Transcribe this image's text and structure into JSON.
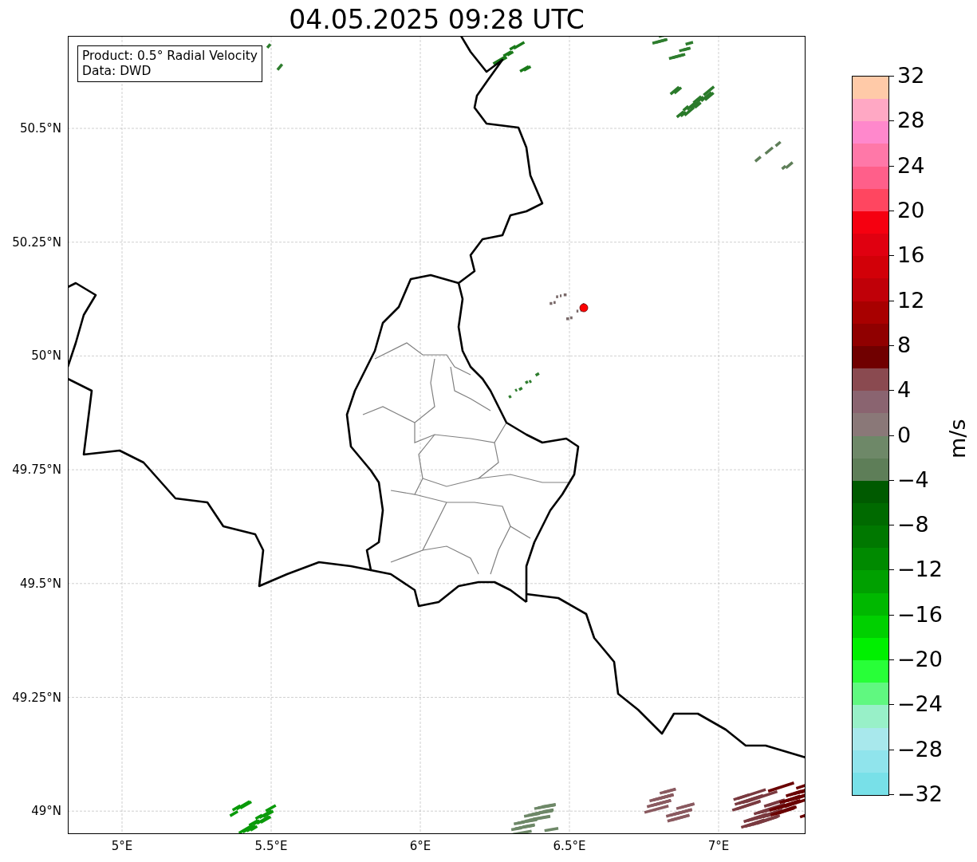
{
  "title": "04.05.2025 09:28 UTC",
  "map": {
    "legend": [
      "Product: 0.5° Radial Velocity",
      "Data: DWD"
    ],
    "x_ticks": [
      "5°E",
      "5.5°E",
      "6°E",
      "6.5°E",
      "7°E"
    ],
    "y_ticks": [
      "50.5°N",
      "50.25°N",
      "50°N",
      "49.75°N",
      "49.5°N",
      "49.25°N",
      "49°N"
    ]
  },
  "colorbar": {
    "unit": "m/s",
    "labels": [
      "32",
      "28",
      "24",
      "20",
      "16",
      "12",
      "8",
      "4",
      "0",
      "−4",
      "−8",
      "−12",
      "−16",
      "−20",
      "−24",
      "−28",
      "−32"
    ],
    "bands": [
      {
        "color": "#ffcaa8"
      },
      {
        "color": "#ffa8c4"
      },
      {
        "color": "#ff88cc"
      },
      {
        "color": "#ff78a8"
      },
      {
        "color": "#ff5f8a"
      },
      {
        "color": "#ff4660"
      },
      {
        "color": "#f50010"
      },
      {
        "color": "#e00010"
      },
      {
        "color": "#d20008"
      },
      {
        "color": "#c00008"
      },
      {
        "color": "#a80000"
      },
      {
        "color": "#900000"
      },
      {
        "color": "#700000"
      },
      {
        "color": "#8a4a50"
      },
      {
        "color": "#8a6470"
      },
      {
        "color": "#8a7878"
      },
      {
        "color": "#6e8868"
      },
      {
        "color": "#5e7e58"
      },
      {
        "color": "#005a00"
      },
      {
        "color": "#006a00"
      },
      {
        "color": "#007800"
      },
      {
        "color": "#008a00"
      },
      {
        "color": "#00a000"
      },
      {
        "color": "#00b800"
      },
      {
        "color": "#00d000"
      },
      {
        "color": "#00f000"
      },
      {
        "color": "#28ff38"
      },
      {
        "color": "#60f880"
      },
      {
        "color": "#98f0c8"
      },
      {
        "color": "#a8e8ec"
      },
      {
        "color": "#90e4ec"
      },
      {
        "color": "#78e0e8"
      }
    ]
  }
}
